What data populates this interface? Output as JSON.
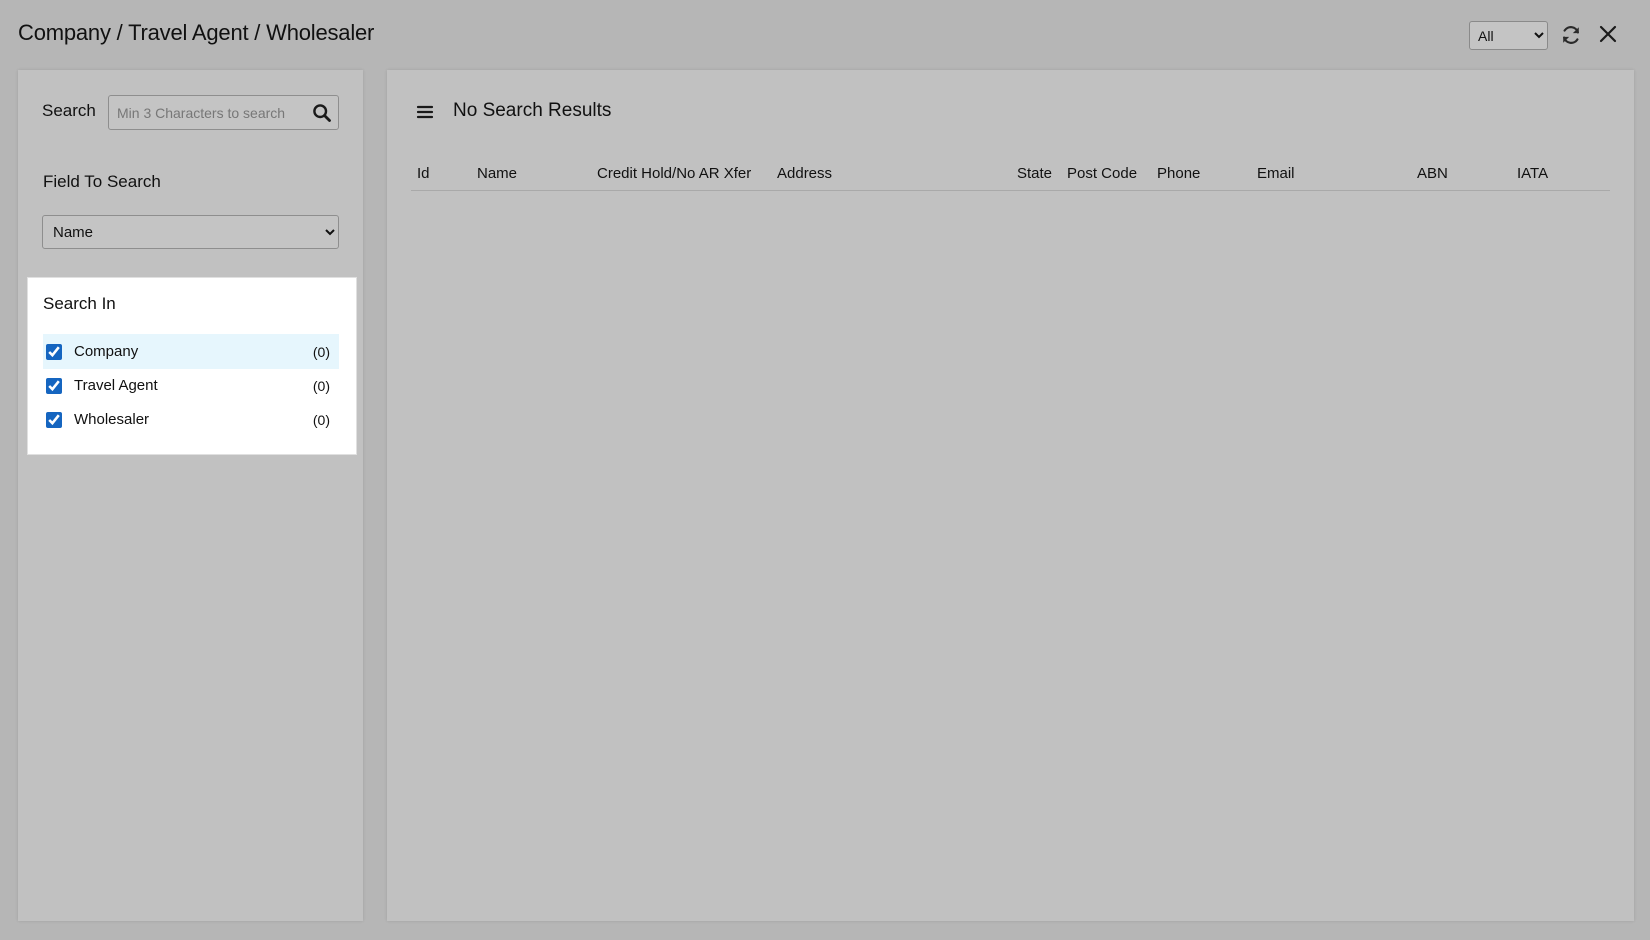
{
  "header": {
    "title": "Company / Travel Agent / Wholesaler",
    "filter_selected": "All",
    "refresh_icon": "refresh-icon",
    "close_icon": "close-icon"
  },
  "sidebar": {
    "search_label": "Search",
    "search_placeholder": "Min 3 Characters to search",
    "search_value": "",
    "search_icon": "search-icon",
    "field_label": "Field To Search",
    "field_selected": "Name",
    "search_in": {
      "title": "Search In",
      "items": [
        {
          "label": "Company",
          "count": "(0)",
          "checked": true
        },
        {
          "label": "Travel Agent",
          "count": "(0)",
          "checked": true
        },
        {
          "label": "Wholesaler",
          "count": "(0)",
          "checked": true
        }
      ]
    }
  },
  "results": {
    "menu_icon": "hamburger-menu-icon",
    "title": "No Search Results",
    "columns": [
      "Id",
      "Name",
      "Credit Hold/No AR Xfer",
      "Address",
      "State",
      "Post Code",
      "Phone",
      "Email",
      "ABN",
      "IATA"
    ],
    "rows": []
  },
  "colors": {
    "background": "#b6b6b6",
    "panel": "#c1c1c1",
    "card": "#ffffff",
    "row_highlight": "#e6f6fd",
    "checkbox": "#1565c0"
  }
}
